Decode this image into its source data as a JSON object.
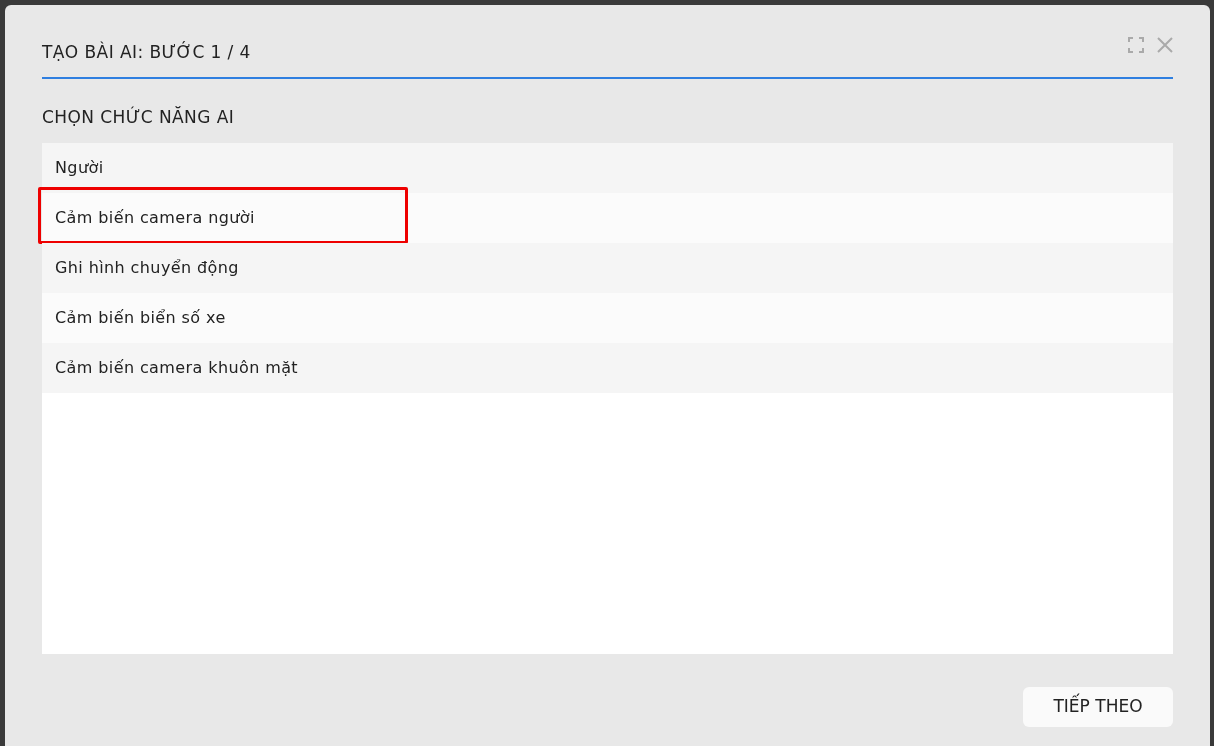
{
  "dialog": {
    "title": "TẠO BÀI AI: BƯỚC 1 / 4"
  },
  "section_label": "CHỌN CHỨC NĂNG AI",
  "items": [
    {
      "label": "Người",
      "highlighted": false
    },
    {
      "label": "Cảm biến camera người",
      "highlighted": true
    },
    {
      "label": "Ghi hình chuyển động",
      "highlighted": false
    },
    {
      "label": "Cảm biến biển số xe",
      "highlighted": false
    },
    {
      "label": "Cảm biến camera khuôn mặt",
      "highlighted": false
    }
  ],
  "next_button": "TIẾP THEO"
}
